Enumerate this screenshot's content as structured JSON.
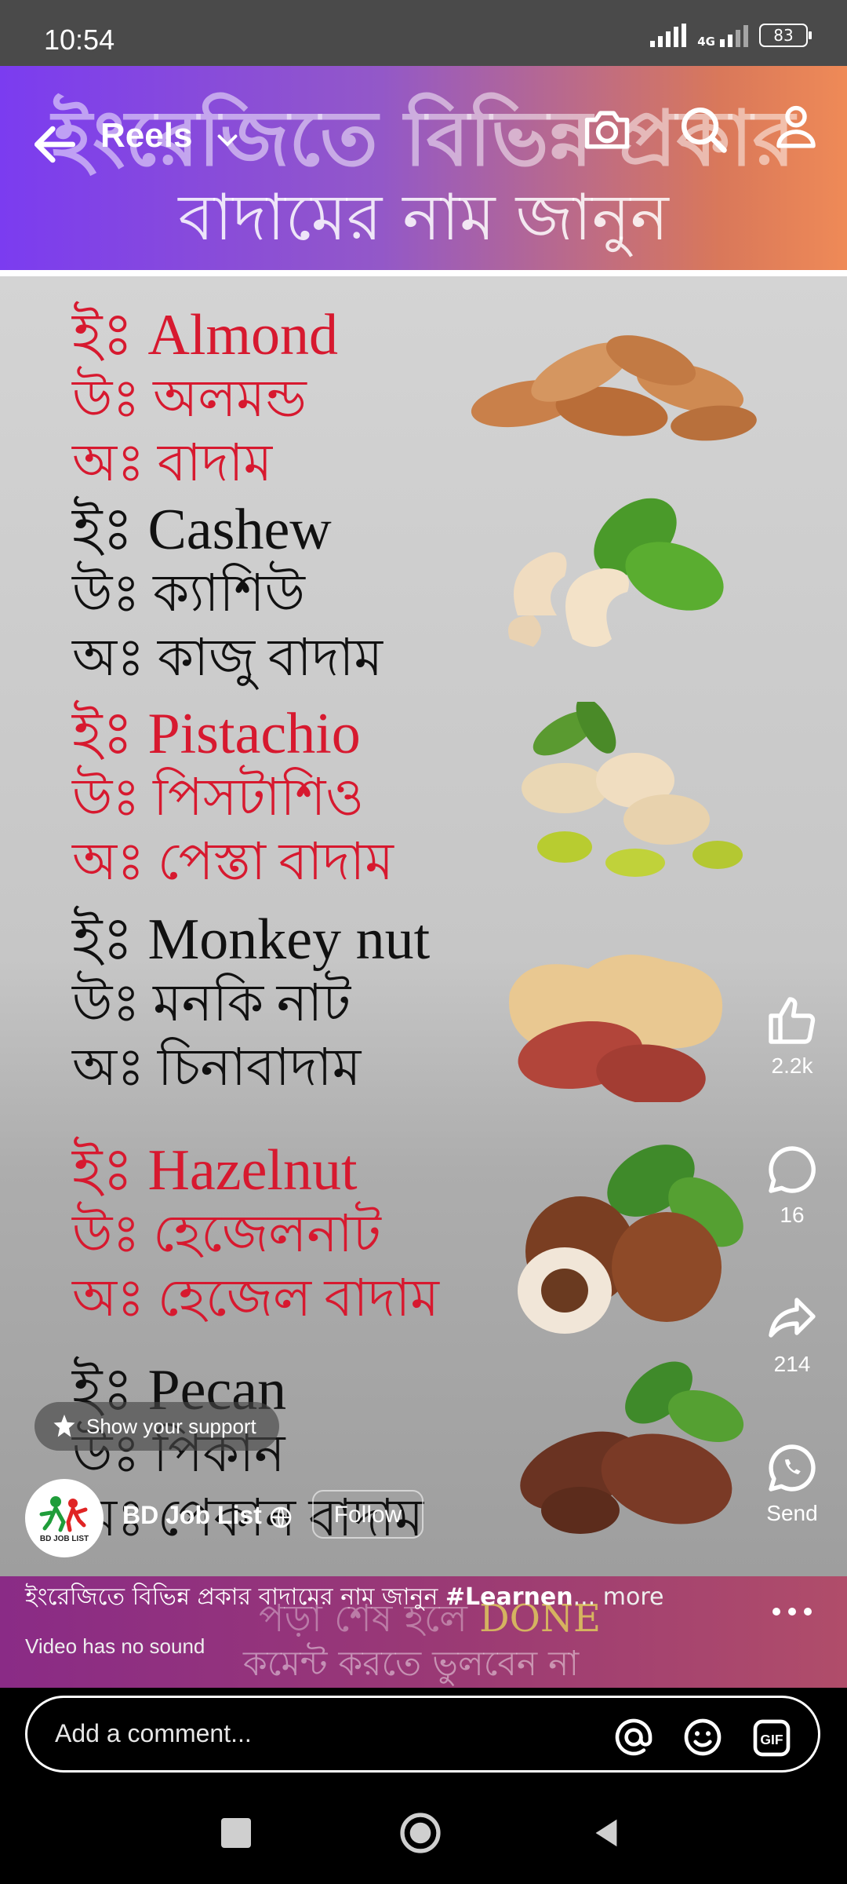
{
  "status_bar": {
    "time": "10:54",
    "network": "4G",
    "battery": "83"
  },
  "header": {
    "back_icon": "arrow-left-icon",
    "title": "Reels",
    "icons": [
      "camera-icon",
      "search-icon",
      "profile-icon"
    ]
  },
  "video": {
    "banner_line1": "ইংরেজিতে বিভিন্ন প্রকার",
    "banner_line2": "বাদামের নাম জানুন",
    "nuts": [
      {
        "line1": "ইঃ Almond",
        "line2": "উঃ অলমন্ড",
        "line3": "অঃ বাদাম",
        "color": "#d7192f"
      },
      {
        "line1": "ইঃ Cashew",
        "line2": "উঃ ক্যাশিউ",
        "line3": "অঃ কাজু বাদাম",
        "color": "#111111"
      },
      {
        "line1": "ইঃ Pistachio",
        "line2": "উঃ পিসটাশিও",
        "line3": "অঃ পেস্তা বাদাম",
        "color": "#d7192f"
      },
      {
        "line1": "ইঃ Monkey nut",
        "line2": "উঃ মনকি নাট",
        "line3": "অঃ চিনাবাদাম",
        "color": "#111111"
      },
      {
        "line1": "ইঃ Hazelnut",
        "line2": "উঃ হেজেলনাট",
        "line3": "অঃ হেজেল বাদাম",
        "color": "#d7192f"
      },
      {
        "line1": "ইঃ Pecan",
        "line2": "উঃ পিকান",
        "line3": "অঃ পেকান বাদাম",
        "color": "#111111"
      }
    ],
    "overlay_line1_a": "পড়া শেষ হলে ",
    "overlay_done": "DONE",
    "overlay_line2": "কমেন্ট করতে ভুলবেন না"
  },
  "rail": {
    "like_count": "2.2k",
    "comment_count": "16",
    "share_count": "214",
    "send_label": "Send"
  },
  "support": {
    "label": "Show your support"
  },
  "channel": {
    "name": "BD Job List",
    "follow_label": "Follow",
    "avatar_text": "BD JOB LIST"
  },
  "caption": {
    "text": "ইংরেজিতে বিভিন্ন প্রকার বাদামের নাম জানুন ",
    "hashtag": "#Learnen",
    "more": "... more",
    "no_sound": "Video has no sound"
  },
  "comment": {
    "placeholder": "Add a comment..."
  },
  "colors": {
    "banner_start": "#7b3cf0",
    "banner_end": "#ef8a57",
    "red_text": "#d7192f",
    "caption_bg": "#8a2b86"
  }
}
